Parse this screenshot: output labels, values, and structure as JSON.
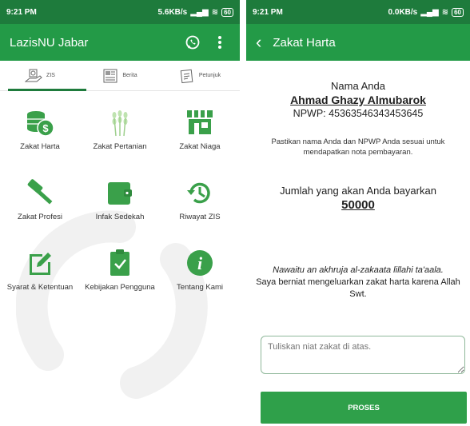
{
  "colors": {
    "status": "#1e7b3c",
    "appbar": "#239a47",
    "accent": "#2fa04a",
    "icon_green": "#3aa04a"
  },
  "left": {
    "status": {
      "time": "9:21 PM",
      "net": "5.6KB/s",
      "battery": "60"
    },
    "appbar": {
      "title": "LazisNU Jabar",
      "icons": [
        "whatsapp-icon",
        "more-vert-icon"
      ]
    },
    "tabs": [
      {
        "label": "ZIS",
        "icon": "coins-hand-icon"
      },
      {
        "label": "Berita",
        "icon": "newspaper-icon"
      },
      {
        "label": "Petunjuk",
        "icon": "document-icon"
      }
    ],
    "menu": [
      {
        "label": "Zakat Harta",
        "icon": "coins-dollar-icon"
      },
      {
        "label": "Zakat Pertanian",
        "icon": "wheat-icon"
      },
      {
        "label": "Zakat Niaga",
        "icon": "store-icon"
      },
      {
        "label": "Zakat Profesi",
        "icon": "hammer-icon"
      },
      {
        "label": "Infak Sedekah",
        "icon": "wallet-icon"
      },
      {
        "label": "Riwayat ZIS",
        "icon": "history-icon"
      },
      {
        "label": "Syarat & Ketentuan",
        "icon": "edit-icon"
      },
      {
        "label": "Kebijakan Pengguna",
        "icon": "clipboard-check-icon"
      },
      {
        "label": "Tentang Kami",
        "icon": "info-icon"
      }
    ]
  },
  "right": {
    "status": {
      "time": "9:21 PM",
      "net": "0.0KB/s",
      "battery": "60"
    },
    "appbar": {
      "title": "Zakat Harta"
    },
    "name_label": "Nama Anda",
    "name_value": "Ahmad Ghazy Almubarok",
    "npwp": "NPWP: 45363546343453645",
    "note": "Pastikan nama Anda dan NPWP Anda sesuai untuk mendapatkan nota pembayaran.",
    "pay_label": "Jumlah yang akan Anda bayarkan",
    "pay_value": "50000",
    "niat_arabic": "Nawaitu an akhruja al-zakaata lillahi ta'aala.",
    "niat_text": "Saya berniat mengeluarkan zakat harta karena Allah Swt.",
    "input_placeholder": "Tuliskan niat zakat di atas.",
    "button_label": "PROSES"
  }
}
